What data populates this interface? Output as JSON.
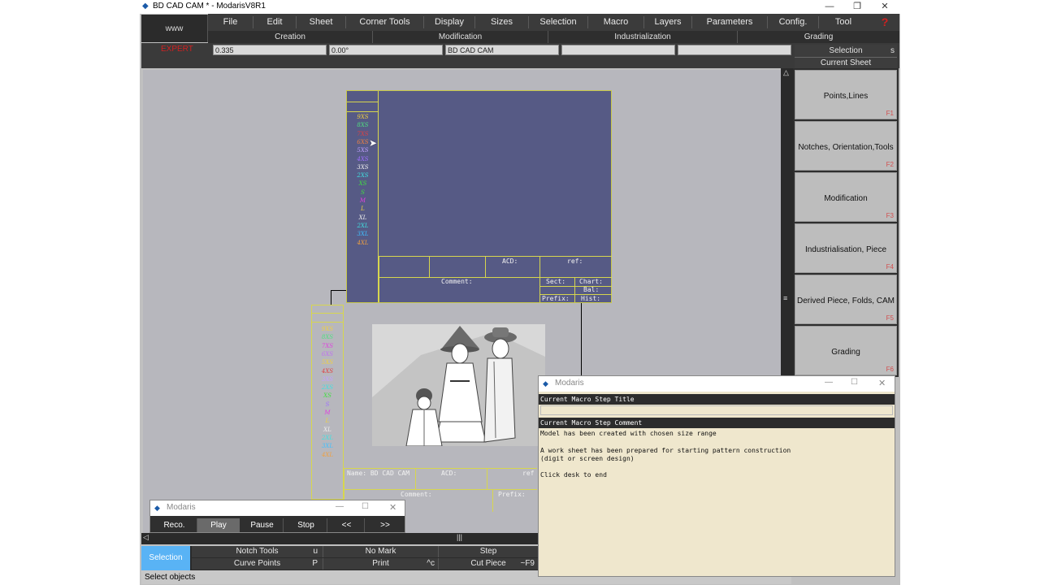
{
  "window": {
    "title": "BD CAD CAM *  - ModarisV8R1",
    "min": "—",
    "max": "❐",
    "close": "✕"
  },
  "www_label": "www",
  "menu": [
    "File",
    "Edit",
    "Sheet",
    "Corner Tools",
    "Display",
    "Sizes",
    "Selection",
    "Macro",
    "Layers",
    "Parameters",
    "Config.",
    "Tool",
    "?"
  ],
  "submenu": [
    "Creation",
    "Modification",
    "Industrialization",
    "Grading"
  ],
  "inputs": {
    "expert": "EXPERT",
    "value1": "0.335",
    "value2": "0.00°",
    "value3": "BD CAD CAM",
    "value4": "",
    "value5": ""
  },
  "selection_header": "Selection",
  "selection_shortcut": "s",
  "current_sheet": "Current Sheet",
  "panel_buttons": [
    {
      "label": "Points,Lines",
      "key": "F1"
    },
    {
      "label": "Notches, Orientation,Tools",
      "key": "F2"
    },
    {
      "label": "Modification",
      "key": "F3"
    },
    {
      "label": "Industrialisation, Piece",
      "key": "F4"
    },
    {
      "label": "Derived Piece, Folds, CAM",
      "key": "F5"
    },
    {
      "label": "Grading",
      "key": "F6"
    }
  ],
  "sheet1": {
    "sizes": [
      {
        "t": "9XS",
        "c": "#f0d040"
      },
      {
        "t": "8XS",
        "c": "#50e080"
      },
      {
        "t": "7XS",
        "c": "#e04040"
      },
      {
        "t": "6XS",
        "c": "#f08040"
      },
      {
        "t": "5XS",
        "c": "#c0a0ff"
      },
      {
        "t": "4XS",
        "c": "#a070ff"
      },
      {
        "t": "3XS",
        "c": "#f0f0f0"
      },
      {
        "t": "2XS",
        "c": "#40e0e0"
      },
      {
        "t": "XS",
        "c": "#40e040"
      },
      {
        "t": "S",
        "c": "#40e040"
      },
      {
        "t": "M",
        "c": "#e040e0"
      },
      {
        "t": "L",
        "c": "#f0d040"
      },
      {
        "t": "XL",
        "c": "#f0f0f0"
      },
      {
        "t": "2XL",
        "c": "#40e0e0"
      },
      {
        "t": "3XL",
        "c": "#40c0ff"
      },
      {
        "t": "4XL",
        "c": "#f0a040"
      }
    ],
    "acd": "ACD:",
    "ref": "ref:",
    "comment": "Comment:",
    "sect": "Sect:",
    "chart": "Chart:",
    "bal": "Bal:",
    "prefix": "Prefix:",
    "hist": "Hist:"
  },
  "sheet2": {
    "sizes": [
      {
        "t": "9XS",
        "c": "#f0d040"
      },
      {
        "t": "8XS",
        "c": "#50e080"
      },
      {
        "t": "7XS",
        "c": "#e040e0"
      },
      {
        "t": "6XS",
        "c": "#c070f0"
      },
      {
        "t": "5XS",
        "c": "#f0d040"
      },
      {
        "t": "4XS",
        "c": "#e04040"
      },
      {
        "t": "3XS",
        "c": "#c0a0ff"
      },
      {
        "t": "2XS",
        "c": "#40e0e0"
      },
      {
        "t": "XS",
        "c": "#40e040"
      },
      {
        "t": "S",
        "c": "#a070ff"
      },
      {
        "t": "M",
        "c": "#e040e0"
      },
      {
        "t": "L",
        "c": "#f0d040"
      },
      {
        "t": "XL",
        "c": "#f0f0f0"
      },
      {
        "t": "2XL",
        "c": "#40e0e0"
      },
      {
        "t": "3XL",
        "c": "#40c0ff"
      },
      {
        "t": "4XL",
        "c": "#f0a040"
      }
    ],
    "name": "Name: BD CAD CAM",
    "acd": "ACD:",
    "ref": "ref",
    "comment": "Comment:",
    "prefix": "Prefix:"
  },
  "macro_player": {
    "title": "Modaris",
    "buttons": [
      "Reco.",
      "Play",
      "Pause",
      "Stop",
      "<<",
      ">>"
    ]
  },
  "macro_dialog": {
    "title": "Modaris",
    "step_title_label": "Current Macro Step Title",
    "step_title_value": "",
    "step_comment_label": "Current Macro Step Comment",
    "comment_lines": [
      "Model has been created with chosen size range",
      "",
      "A work sheet has been prepared for starting pattern construction",
      "(digit or screen design)",
      "",
      "Click desk to end"
    ]
  },
  "toolbar": {
    "selection": "Selection",
    "notch_tools": "Notch Tools",
    "notch_key": "u",
    "no_mark": "No Mark",
    "step": "Step",
    "curve_points": "Curve Points",
    "curve_key": "P",
    "print": "Print",
    "print_key": "^c",
    "cut_piece": "Cut Piece",
    "cut_key": "~F9"
  },
  "status": "Select objects"
}
